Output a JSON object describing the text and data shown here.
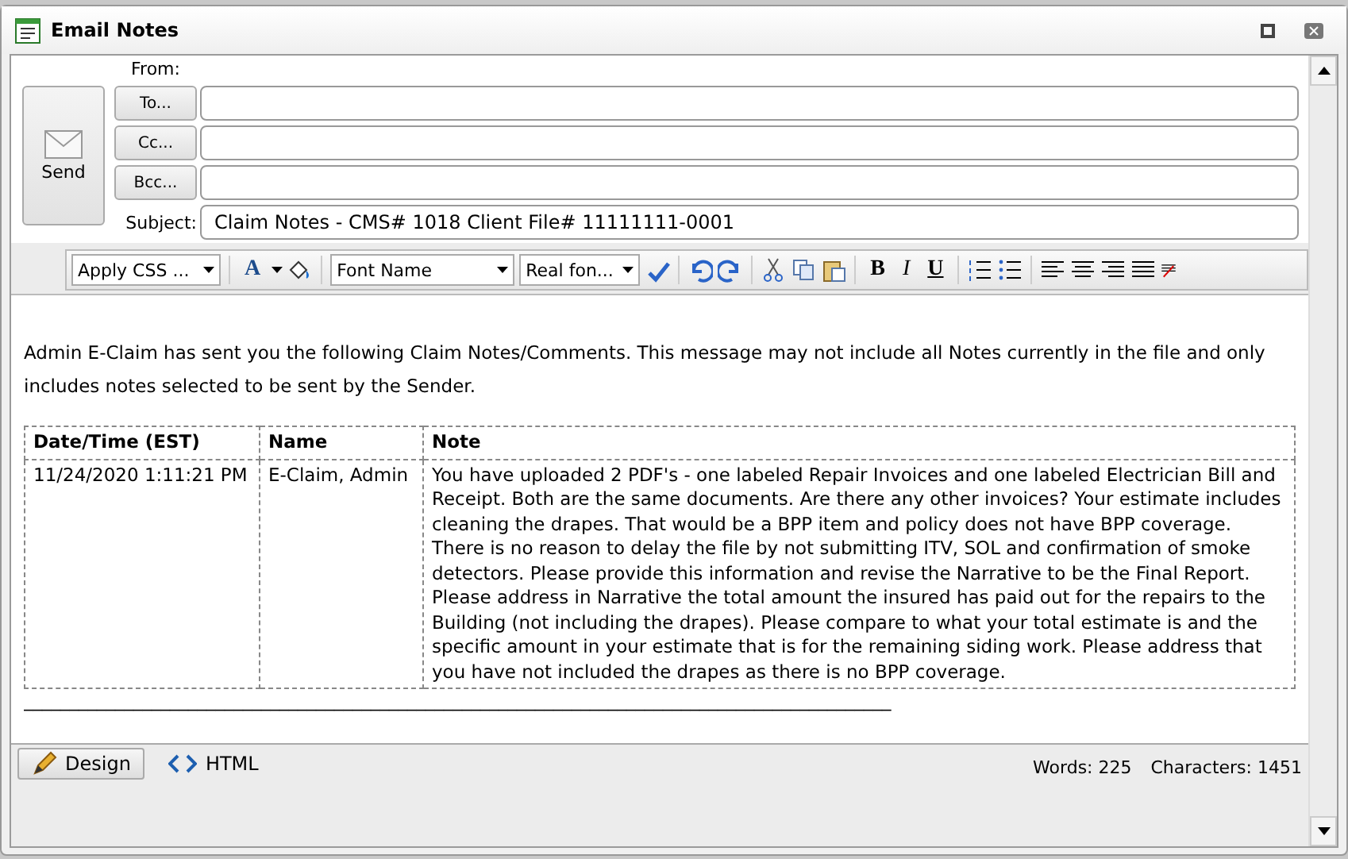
{
  "window": {
    "title": "Email Notes"
  },
  "header": {
    "send": "Send",
    "from_label": "From:",
    "recipients": [
      {
        "button": "To..."
      },
      {
        "button": "Cc..."
      },
      {
        "button": "Bcc..."
      }
    ],
    "subject_label": "Subject:",
    "subject": "Claim Notes - CMS# 1018 Client File# 11111111-0001"
  },
  "toolbar": {
    "css_dropdown": "Apply CSS ...",
    "font_name": "Font Name",
    "font_size": "Real fon...",
    "font_color": "A",
    "bold": "B",
    "italic": "I",
    "underline": "U"
  },
  "body": {
    "intro": "Admin E-Claim has sent you the following Claim Notes/Comments. This message may not include all Notes currently in the file and only includes notes selected to be sent by the Sender.",
    "table": {
      "columns": [
        "Date/Time (EST)",
        "Name",
        "Note"
      ],
      "rows": [
        [
          "11/24/2020 1:11:21 PM",
          "E-Claim, Admin",
          "You have uploaded 2 PDF's - one labeled Repair Invoices and one labeled Electrician Bill and Receipt. Both are the same documents.  Are there any other invoices? Your estimate includes cleaning the drapes.  That would be a BPP item and policy does not have BPP coverage. There is no reason to delay the file by not submitting ITV, SOL and confirmation of smoke detectors.  Please provide this information and revise the Narrative to be the Final Report. Please address in Narrative the total amount the insured has paid out for the repairs to the Building (not including the drapes).  Please compare to what your total estimate is and the specific amount in your estimate that is for the remaining siding work. Please address that you have not included the drapes as there is no BPP coverage."
        ]
      ]
    },
    "rule": "_______________________________________________________________________________________________"
  },
  "mode_tabs": [
    {
      "label": "Design",
      "selected": true,
      "kind": "design"
    },
    {
      "label": "HTML",
      "selected": false,
      "kind": "html"
    }
  ],
  "status": {
    "words": "Words: 225",
    "characters": "Characters: 1451"
  }
}
